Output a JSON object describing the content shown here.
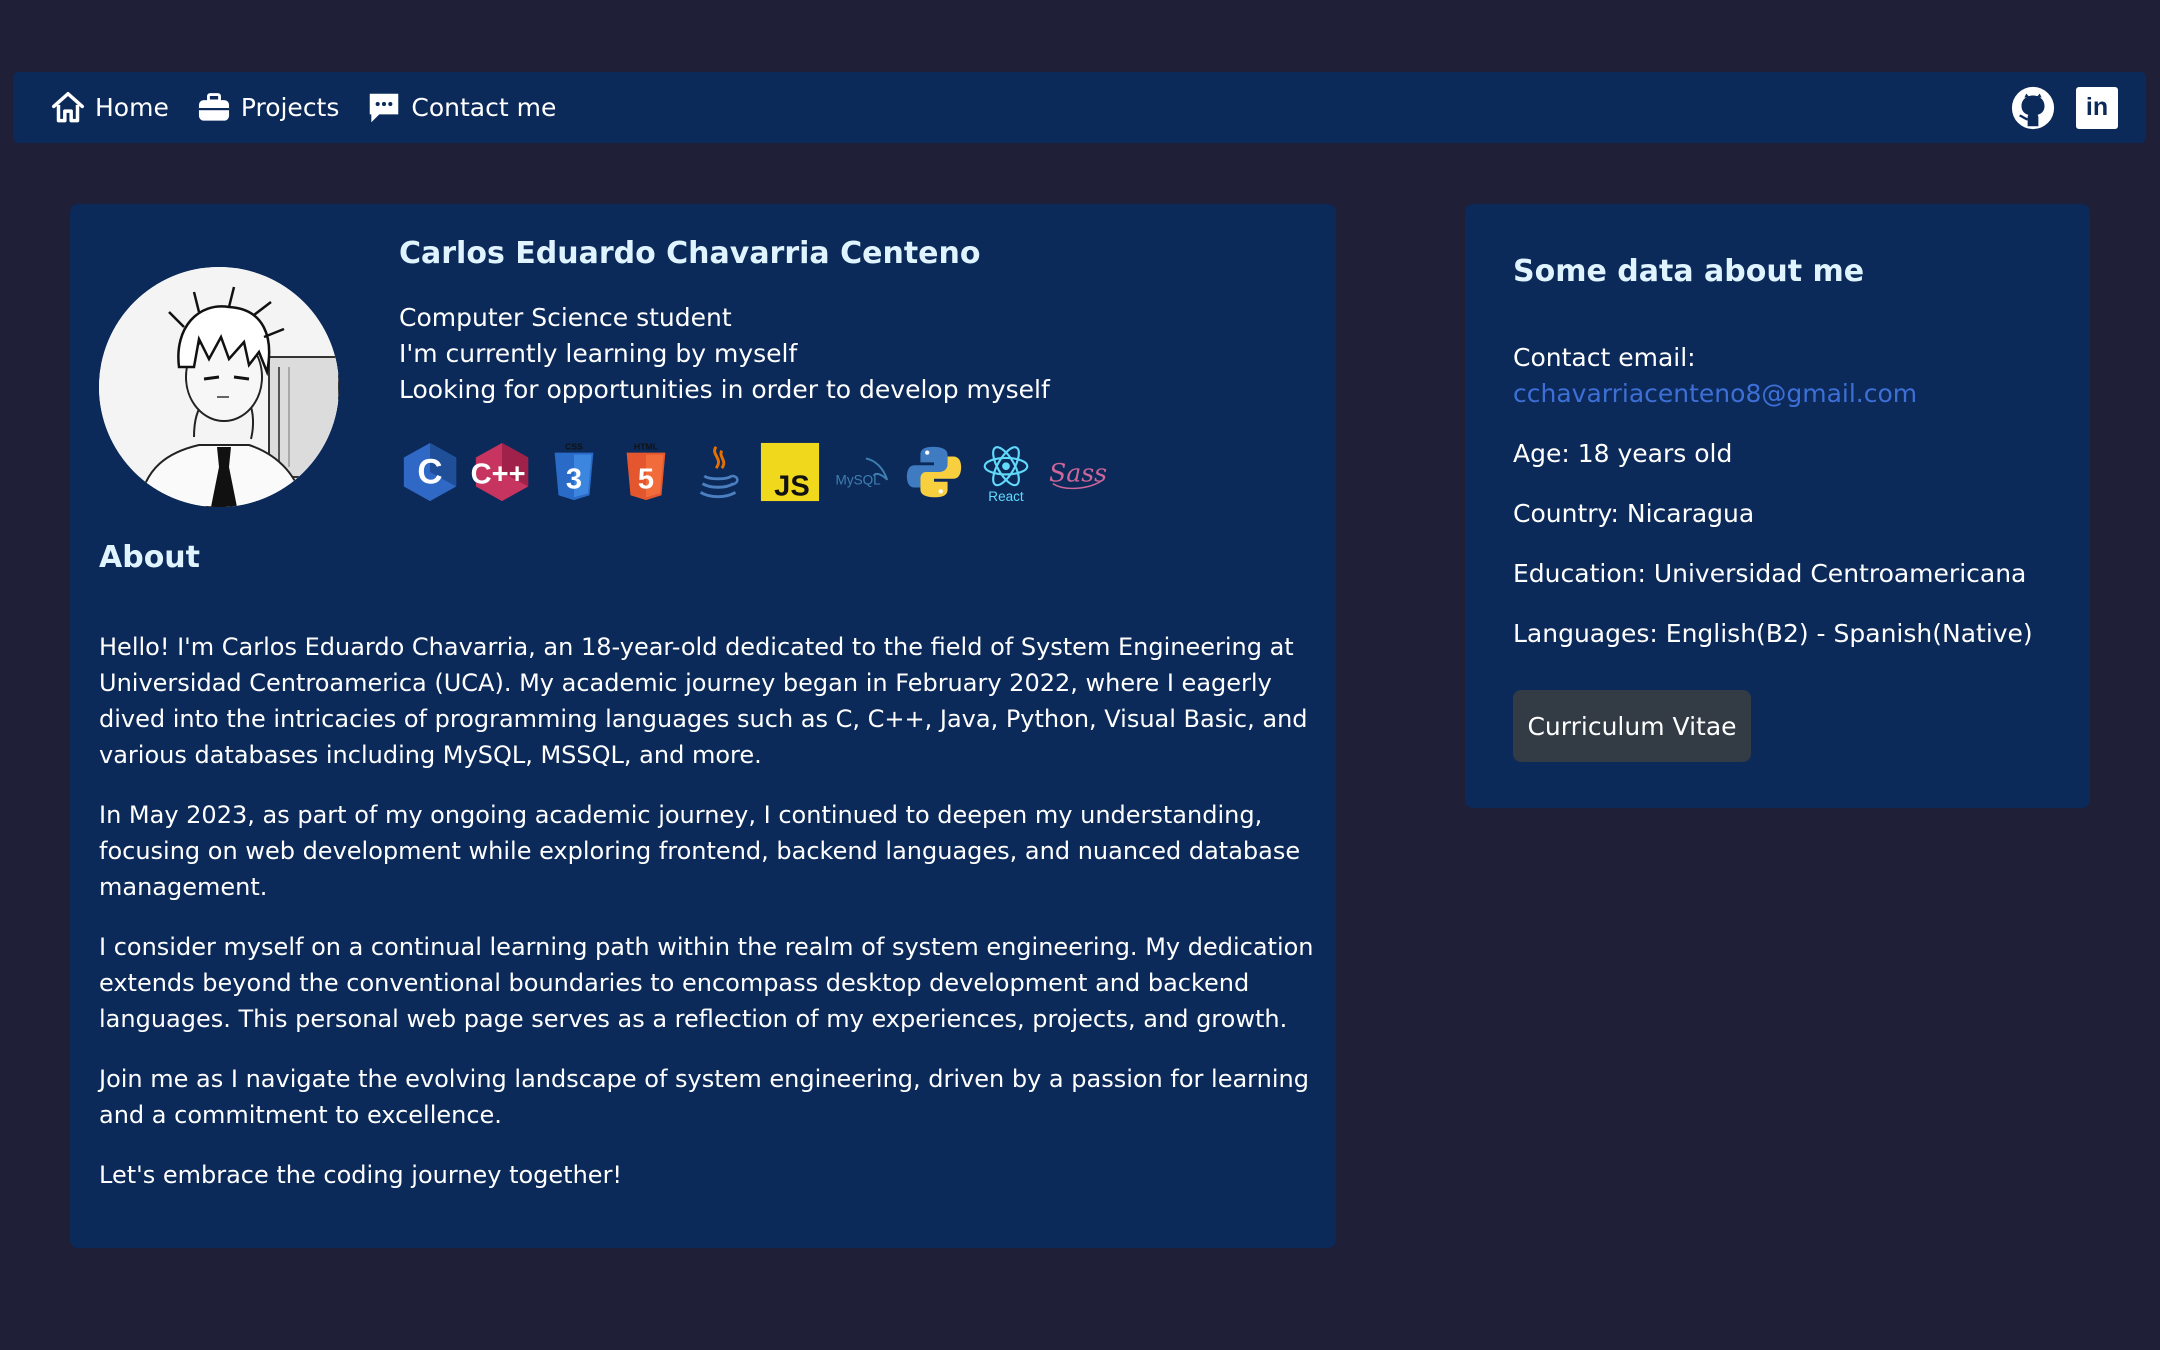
{
  "nav": {
    "items": [
      {
        "label": "Home",
        "icon": "home-icon"
      },
      {
        "label": "Projects",
        "icon": "briefcase-icon"
      },
      {
        "label": "Contact me",
        "icon": "chat-icon"
      }
    ],
    "social": [
      {
        "name": "github-icon"
      },
      {
        "name": "linkedin-icon",
        "text": "in"
      }
    ]
  },
  "profile": {
    "name": "Carlos Eduardo Chavarria Centeno",
    "taglines": [
      "Computer Science student",
      "I'm currently learning by myself",
      "Looking for opportunities in order to develop myself"
    ],
    "tech_icons": [
      {
        "name": "c-icon",
        "text": "C"
      },
      {
        "name": "cpp-icon",
        "text": "C++"
      },
      {
        "name": "css3-icon",
        "text": "CSS"
      },
      {
        "name": "html5-icon",
        "text": "HTML"
      },
      {
        "name": "java-icon"
      },
      {
        "name": "javascript-icon",
        "text": "JS"
      },
      {
        "name": "mysql-icon",
        "text": "MySQL"
      },
      {
        "name": "python-icon"
      },
      {
        "name": "react-icon",
        "text": "React"
      },
      {
        "name": "sass-icon",
        "text": "Sass"
      }
    ]
  },
  "about": {
    "title": "About",
    "paragraphs": [
      "Hello! I'm Carlos Eduardo Chavarria, an 18-year-old dedicated to the field of System Engineering at Universidad Centroamerica (UCA). My academic journey began in February 2022, where I eagerly dived into the intricacies of programming languages such as C, C++, Java, Python, Visual Basic, and various databases including MySQL, MSSQL, and more.",
      "In May 2023, as part of my ongoing academic journey, I continued to deepen my understanding, focusing on web development while exploring frontend, backend languages, and nuanced database management.",
      "I consider myself on a continual learning path within the realm of system engineering. My dedication extends beyond the conventional boundaries to encompass desktop development and backend languages. This personal web page serves as a reflection of my experiences, projects, and growth.",
      "Join me as I navigate the evolving landscape of system engineering, driven by a passion for learning and a commitment to excellence.",
      "Let's embrace the coding journey together!"
    ]
  },
  "side": {
    "title": "Some data about me",
    "email_label": "Contact email:",
    "email": "cchavarriacenteno8@gmail.com",
    "age": "Age: 18 years old",
    "country": "Country: Nicaragua",
    "education": "Education: Universidad Centroamericana",
    "languages": "Languages: English(B2) - Spanish(Native)",
    "cv_button": "Curriculum Vitae"
  },
  "colors": {
    "background": "#1f1f38",
    "card": "#0b2a5a",
    "heading": "#dff4ff",
    "link": "#3d6fd6",
    "button": "#333b45"
  }
}
